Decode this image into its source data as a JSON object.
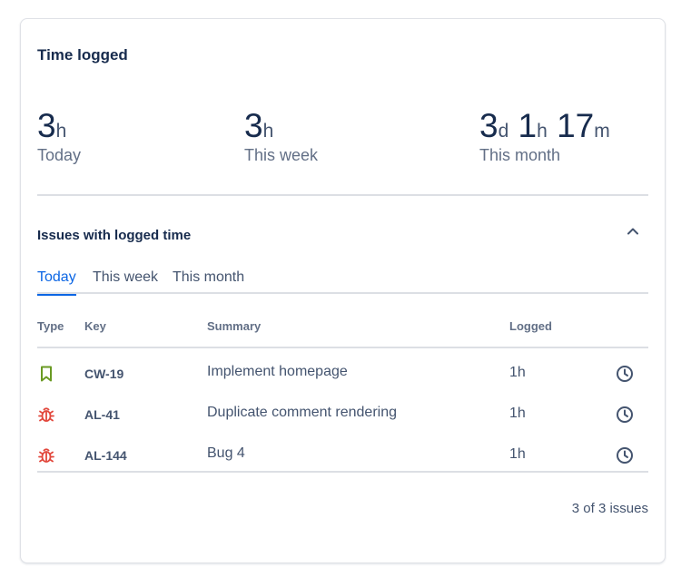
{
  "card": {
    "title": "Time logged",
    "stats": {
      "today": {
        "value": "3",
        "unit": "h",
        "label": "Today"
      },
      "week": {
        "value": "3",
        "unit": "h",
        "label": "This week"
      },
      "month": {
        "d_value": "3",
        "d_unit": "d",
        "h_value": "1",
        "h_unit": "h",
        "m_value": "17",
        "m_unit": "m",
        "label": "This month"
      }
    }
  },
  "issues": {
    "section_title": "Issues with logged time",
    "collapse_icon": "chevron-up-icon",
    "tabs": [
      {
        "label": "Today",
        "active": true
      },
      {
        "label": "This week",
        "active": false
      },
      {
        "label": "This month",
        "active": false
      }
    ],
    "columns": {
      "type": "Type",
      "key": "Key",
      "summary": "Summary",
      "logged": "Logged"
    },
    "rows": [
      {
        "type_icon": "story-bookmark-icon",
        "type_color": "#6a9a23",
        "key": "CW-19",
        "summary": "Implement homepage",
        "logged": "1h",
        "action_icon": "clock-icon"
      },
      {
        "type_icon": "bug-icon",
        "type_color": "#e2483d",
        "key": "AL-41",
        "summary": "Duplicate comment rendering",
        "logged": "1h",
        "action_icon": "clock-icon"
      },
      {
        "type_icon": "bug-icon",
        "type_color": "#e2483d",
        "key": "AL-144",
        "summary": "Bug 4",
        "logged": "1h",
        "action_icon": "clock-icon"
      }
    ],
    "footer": "3 of 3 issues"
  },
  "colors": {
    "accent": "#0c66e4",
    "text": "#172b4d",
    "subtle": "#44546f",
    "divider": "#dcdfe4"
  }
}
